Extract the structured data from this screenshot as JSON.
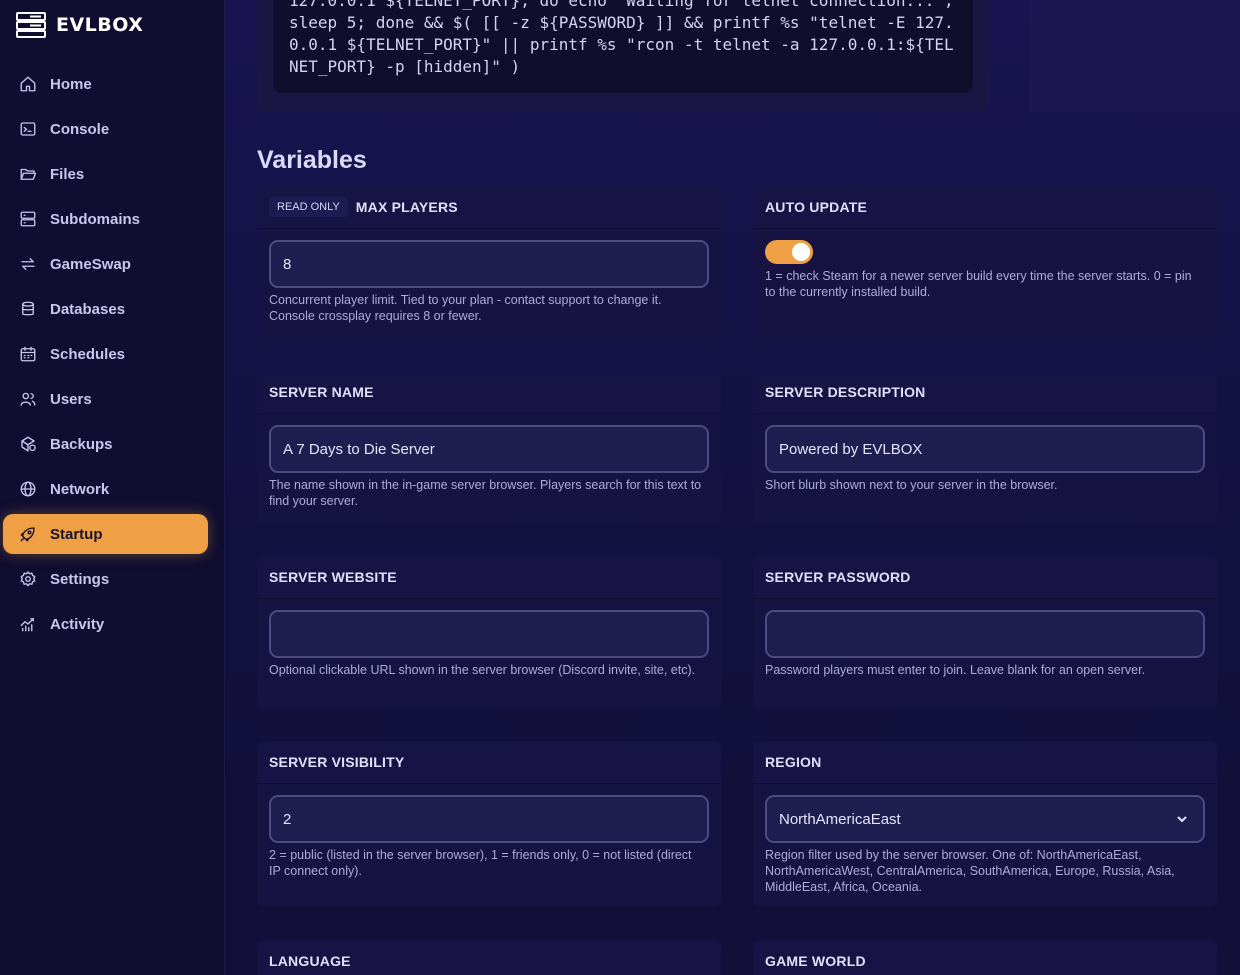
{
  "brand": {
    "name": "EVLBOX"
  },
  "sidebar": {
    "items": [
      {
        "label": "Home",
        "icon": "home-icon"
      },
      {
        "label": "Console",
        "icon": "terminal-icon"
      },
      {
        "label": "Files",
        "icon": "folder-icon"
      },
      {
        "label": "Subdomains",
        "icon": "server-icon"
      },
      {
        "label": "GameSwap",
        "icon": "swap-icon"
      },
      {
        "label": "Databases",
        "icon": "database-icon"
      },
      {
        "label": "Schedules",
        "icon": "calendar-icon"
      },
      {
        "label": "Users",
        "icon": "users-icon"
      },
      {
        "label": "Backups",
        "icon": "backup-icon"
      },
      {
        "label": "Network",
        "icon": "globe-icon"
      },
      {
        "label": "Startup",
        "icon": "rocket-icon",
        "active": true
      },
      {
        "label": "Settings",
        "icon": "gear-icon"
      },
      {
        "label": "Activity",
        "icon": "chart-icon"
      }
    ]
  },
  "startup_command": {
    "text": "127.0.0.1 ${TELNET_PORT}; do echo \"Waiting for telnet connection...\"; sleep 5; done && $( [[ -z ${PASSWORD} ]] && printf %s \"telnet -E 127.0.0.1 ${TELNET_PORT}\" || printf %s \"rcon -t telnet -a 127.0.0.1:${TELNET_PORT} -p [hidden]\" )"
  },
  "variables": {
    "title": "Variables",
    "max_players": {
      "badge": "READ ONLY",
      "title": "MAX PLAYERS",
      "value": "8",
      "help": "Concurrent player limit. Tied to your plan - contact support to change it. Console crossplay requires 8 or fewer."
    },
    "auto_update": {
      "title": "AUTO UPDATE",
      "enabled": true,
      "help": "1 = check Steam for a newer server build every time the server starts. 0 = pin to the currently installed build."
    },
    "server_name": {
      "title": "SERVER NAME",
      "value": "A 7 Days to Die Server",
      "help": "The name shown in the in-game server browser. Players search for this text to find your server."
    },
    "server_description": {
      "title": "SERVER DESCRIPTION",
      "value": "Powered by EVLBOX",
      "help": "Short blurb shown next to your server in the browser."
    },
    "server_website": {
      "title": "SERVER WEBSITE",
      "value": "",
      "help": "Optional clickable URL shown in the server browser (Discord invite, site, etc)."
    },
    "server_password": {
      "title": "SERVER PASSWORD",
      "value": "",
      "help": "Password players must enter to join. Leave blank for an open server."
    },
    "server_visibility": {
      "title": "SERVER VISIBILITY",
      "value": "2",
      "help": "2 = public (listed in the server browser), 1 = friends only, 0 = not listed (direct IP connect only)."
    },
    "region": {
      "title": "REGION",
      "value": "NorthAmericaEast",
      "help": "Region filter used by the server browser. One of: NorthAmericaEast, NorthAmericaWest, CentralAmerica, SouthAmerica, Europe, Russia, Asia, MiddleEast, Africa, Oceania."
    },
    "language": {
      "title": "LANGUAGE"
    },
    "game_world": {
      "title": "GAME WORLD"
    }
  },
  "colors": {
    "accent": "#f0a044",
    "background": "#13113a",
    "sidebar": "#0f0d30",
    "card": "#161343"
  }
}
